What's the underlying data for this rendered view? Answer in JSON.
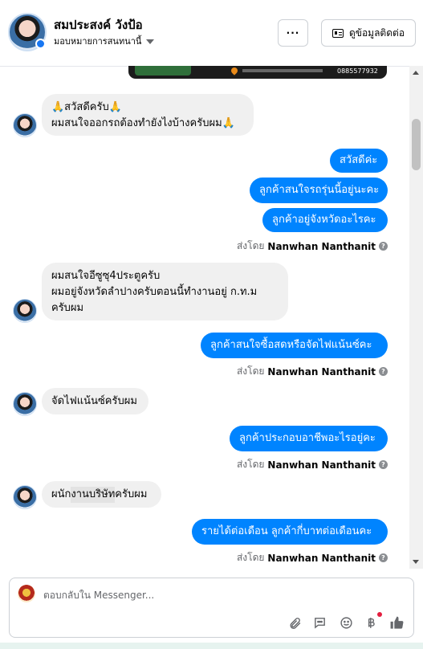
{
  "header": {
    "name": "สมประสงค์ วังป้อ",
    "assign_label": "มอบหมายการสนทนานี้",
    "more_label": "···",
    "contact_label": "ดูข้อมูลติดต่อ"
  },
  "banner": {
    "phone": "0885577932"
  },
  "messages": {
    "m1_line1": "🙏สวัสดีครับ🙏",
    "m1_line2": "ผมสนใจออกรถต้องทำยังไงบ้างครับผม🙏",
    "r1": "สวัสดีค่ะ",
    "r2": "ลูกค้าสนใจรถรุ่นนี้อยู่นะคะ",
    "r3": "ลูกค้าอยู่จังหวัดอะไรคะ",
    "m2_line1": "ผมสนใจอีซูซุ4ประตูครับ",
    "m2_line2": "ผมอยู่จังหวัดลำปางครับตอนนี้ทำงานอยู่ ก.ท.ม",
    "m2_line3": "ครับผม",
    "r4": "ลูกค้าสนใจซื้อสดหรือจัดไฟแน้นซ์คะ",
    "m3": "จัดไฟแน้นซ์ครับผม",
    "r5": "ลูกค้าประกอบอาชีพอะไรอยู่คะ",
    "m4_a": "ผนัก",
    "m4_b": "งานบริษัท",
    "m4_c": "ครับผม",
    "r6": "รายได้ต่อเดือน ลูกค้ากี่บาทต่อเดือนคะ"
  },
  "sent_by": {
    "prefix": "ส่งโดย",
    "agent": "Nanwhan Nanthanit"
  },
  "composer": {
    "placeholder": "ตอบกลับใน Messenger...",
    "icons": [
      "attach-icon",
      "comment-icon",
      "emoji-icon",
      "baht-icon",
      "like-icon"
    ]
  },
  "colors": {
    "outgoing": "#0084ff",
    "incoming": "#f0f0f0",
    "notification": "#e41e3f"
  }
}
